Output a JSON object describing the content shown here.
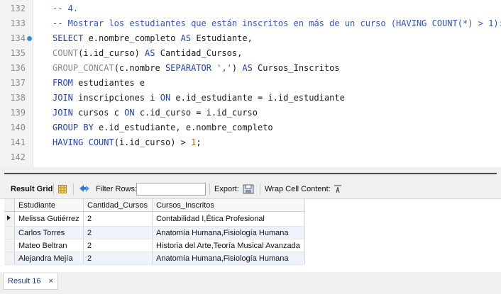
{
  "editor": {
    "lines": [
      {
        "n": "132",
        "segments": [
          {
            "t": "-- 4.",
            "c": "cm-blue"
          }
        ]
      },
      {
        "n": "133",
        "segments": [
          {
            "t": "-- Mostrar los estudiantes que están inscritos en más de un curso (HAVING COUNT(*) > 1):",
            "c": "cm-blue"
          }
        ]
      },
      {
        "n": "134",
        "dot": true,
        "segments": [
          {
            "t": "SELECT",
            "c": "kw"
          },
          {
            "t": " e.nombre_completo ",
            "c": ""
          },
          {
            "t": "AS",
            "c": "kw"
          },
          {
            "t": " Estudiante,",
            "c": ""
          }
        ]
      },
      {
        "n": "135",
        "segments": [
          {
            "t": "COUNT",
            "c": "cm"
          },
          {
            "t": "(i.id_curso) ",
            "c": ""
          },
          {
            "t": "AS",
            "c": "kw"
          },
          {
            "t": " Cantidad_Cursos,",
            "c": ""
          }
        ]
      },
      {
        "n": "136",
        "segments": [
          {
            "t": "GROUP_CONCAT",
            "c": "cm"
          },
          {
            "t": "(c.nombre ",
            "c": ""
          },
          {
            "t": "SEPARATOR",
            "c": "kw"
          },
          {
            "t": " ",
            "c": ""
          },
          {
            "t": "','",
            "c": "str"
          },
          {
            "t": ") ",
            "c": ""
          },
          {
            "t": "AS",
            "c": "kw"
          },
          {
            "t": " Cursos_Inscritos",
            "c": ""
          }
        ]
      },
      {
        "n": "137",
        "segments": [
          {
            "t": "FROM",
            "c": "kw"
          },
          {
            "t": " estudiantes e",
            "c": ""
          }
        ]
      },
      {
        "n": "138",
        "segments": [
          {
            "t": "JOIN",
            "c": "kw"
          },
          {
            "t": " inscripciones i ",
            "c": ""
          },
          {
            "t": "ON",
            "c": "kw"
          },
          {
            "t": " e.id_estudiante = i.id_estudiante",
            "c": ""
          }
        ]
      },
      {
        "n": "139",
        "segments": [
          {
            "t": "JOIN",
            "c": "kw"
          },
          {
            "t": " cursos c ",
            "c": ""
          },
          {
            "t": "ON",
            "c": "kw"
          },
          {
            "t": " c.id_curso = i.id_curso",
            "c": ""
          }
        ]
      },
      {
        "n": "140",
        "segments": [
          {
            "t": "GROUP BY",
            "c": "kw"
          },
          {
            "t": " e.id_estudiante, e.nombre_completo",
            "c": ""
          }
        ]
      },
      {
        "n": "141",
        "segments": [
          {
            "t": "HAVING",
            "c": "kw"
          },
          {
            "t": " ",
            "c": ""
          },
          {
            "t": "COUNT",
            "c": "kw"
          },
          {
            "t": "(i.id_curso) > ",
            "c": ""
          },
          {
            "t": "1",
            "c": "num"
          },
          {
            "t": ";",
            "c": ""
          }
        ]
      },
      {
        "n": "142",
        "segments": []
      }
    ]
  },
  "toolbar": {
    "result_grid": "Result Grid",
    "filter_rows": "Filter Rows:",
    "filter_value": "",
    "export": "Export:",
    "wrap_cell": "Wrap Cell Content:"
  },
  "grid": {
    "columns": [
      "Estudiante",
      "Cantidad_Cursos",
      "Cursos_Inscritos"
    ],
    "rows": [
      [
        "Melissa Gutiérrez",
        "2",
        "Contabilidad I,Ética Profesional"
      ],
      [
        "Carlos Torres",
        "2",
        "Anatomía Humana,Fisiología Humana"
      ],
      [
        "Mateo Beltran",
        "2",
        "Historia del Arte,Teoría Musical Avanzada"
      ],
      [
        "Alejandra Mejía",
        "2",
        "Anatomía Humana,Fisiología Humana"
      ]
    ]
  },
  "bottom": {
    "tab_label": "Result 16",
    "close_glyph": "×"
  }
}
